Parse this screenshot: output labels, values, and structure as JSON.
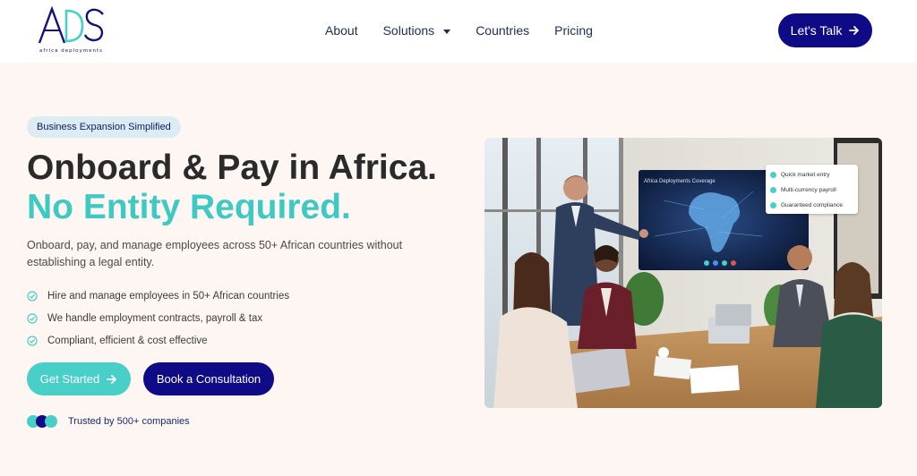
{
  "brand": {
    "logo_text": "ADS",
    "tagline": "africa deployments"
  },
  "nav": {
    "items": [
      {
        "label": "About"
      },
      {
        "label": "Solutions"
      },
      {
        "label": "Countries"
      },
      {
        "label": "Pricing"
      }
    ],
    "cta_label": "Let's Talk"
  },
  "hero": {
    "badge": "Business Expansion Simplified",
    "headline_line1": "Onboard & Pay in Africa.",
    "headline_line2": "No Entity Required.",
    "description": "Onboard, pay, and manage employees across 50+ African countries without establishing a legal entity.",
    "features": [
      "Hire and manage employees in 50+ African countries",
      "We handle employment contracts, payroll & tax",
      "Compliant, efficient & cost effective"
    ],
    "primary_button": "Get Started",
    "secondary_button": "Book a Consultation",
    "trust_text": "Trusted by 500+ companies"
  },
  "image": {
    "screen_title": "Africa Deployments Coverage",
    "overlay_items": [
      "Quick market entry",
      "Multi-currency payroll",
      "Guaranteed compliance"
    ]
  },
  "colors": {
    "navy": "#0f0a86",
    "teal": "#47cfc8",
    "background": "#fdf6f2"
  }
}
